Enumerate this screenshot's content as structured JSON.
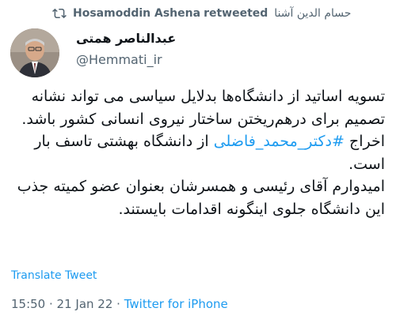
{
  "retweet": {
    "icon": "retweet-icon",
    "retweeter": "Hosamoddin Ashena",
    "action": "retweeted",
    "retweeter_rtl": "حسام الدین آشنا"
  },
  "author": {
    "avatar": "avatar-photo",
    "display_name": "عبدالناصر همتی",
    "handle": "@Hemmati_ir"
  },
  "tweet": {
    "para1": "تسویه اساتید از دانشگاه‌ها بدلایل سیاسی می تواند نشانه تصمیم برای درهم‌ریختن ساختار نیروی انسانی کشور باشد.",
    "para2_before": "اخراج ",
    "para2_hashtag": "#دکتر_محمد_فاضلی",
    "para2_after": " از دانشگاه بهشتی تاسف بار است.",
    "para3": "امیدوارم آقای رئیسی و همسرشان بعنوان عضو کمیته جذب این دانشگاه جلوی اینگونه اقدامات بایستند."
  },
  "translate_label": "Translate Tweet",
  "meta": {
    "time": "15:50",
    "separator": " · ",
    "date": "21 Jan 22",
    "source": "Twitter for iPhone"
  },
  "colors": {
    "link": "#1d9bf0",
    "secondary_text": "#536471",
    "primary_text": "#0f1419"
  }
}
